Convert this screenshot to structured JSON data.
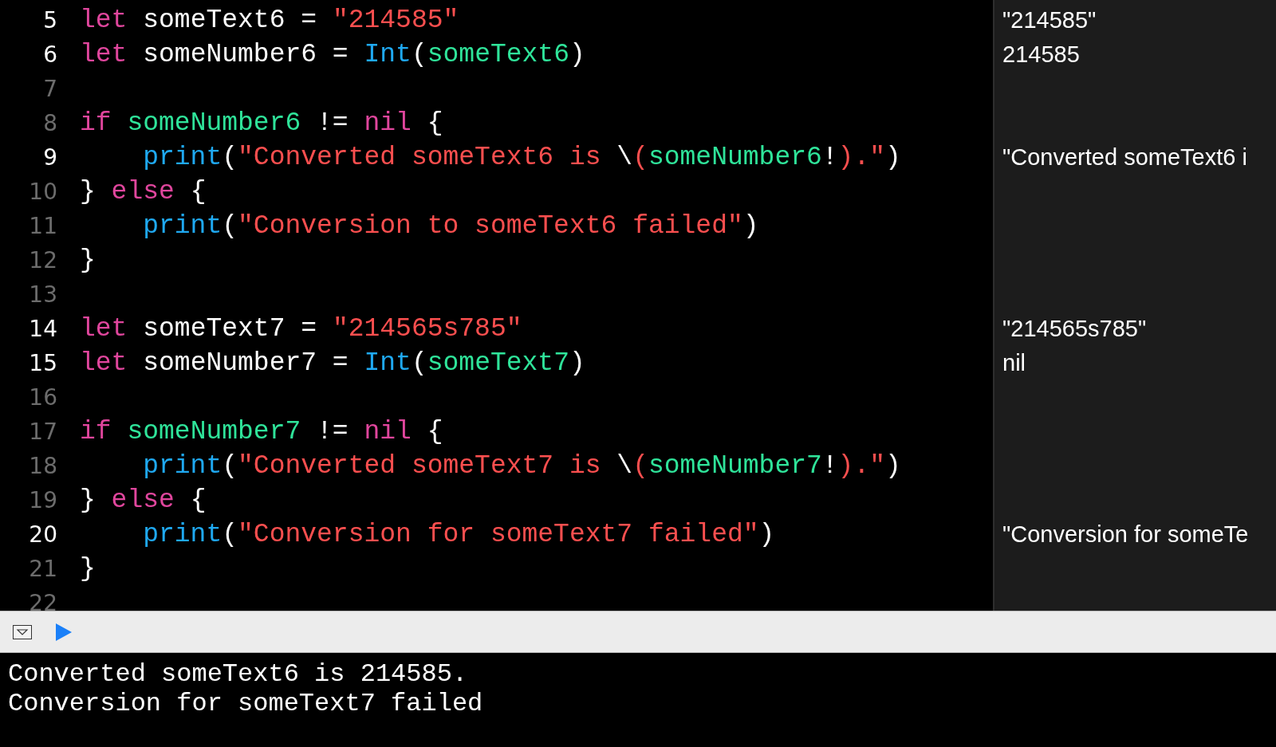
{
  "editor": {
    "lines": [
      {
        "number": "5",
        "highlighted": true,
        "tokens": [
          {
            "kind": "keyword",
            "text": "let"
          },
          {
            "kind": "plain",
            "text": " someText6 = "
          },
          {
            "kind": "string",
            "text": "\"214585\""
          }
        ],
        "result": "\"214585\""
      },
      {
        "number": "6",
        "highlighted": true,
        "tokens": [
          {
            "kind": "keyword",
            "text": "let"
          },
          {
            "kind": "plain",
            "text": " someNumber6 = "
          },
          {
            "kind": "type",
            "text": "Int"
          },
          {
            "kind": "plain",
            "text": "("
          },
          {
            "kind": "variable",
            "text": "someText6"
          },
          {
            "kind": "plain",
            "text": ")"
          }
        ],
        "result": "214585"
      },
      {
        "number": "7",
        "highlighted": false
      },
      {
        "number": "8",
        "highlighted": false,
        "tokens": [
          {
            "kind": "keyword",
            "text": "if "
          },
          {
            "kind": "variable",
            "text": "someNumber6"
          },
          {
            "kind": "plain",
            "text": " != "
          },
          {
            "kind": "keyword",
            "text": "nil"
          },
          {
            "kind": "plain",
            "text": " {"
          }
        ]
      },
      {
        "number": "9",
        "highlighted": true,
        "tokens": [
          {
            "kind": "type",
            "text": "    print"
          },
          {
            "kind": "plain",
            "text": "("
          },
          {
            "kind": "string",
            "text": "\"Converted someText6 is "
          },
          {
            "kind": "plain",
            "text": "\\"
          },
          {
            "kind": "string",
            "text": "("
          },
          {
            "kind": "variable",
            "text": "someNumber6"
          },
          {
            "kind": "plain",
            "text": "!"
          },
          {
            "kind": "string",
            "text": ").\""
          },
          {
            "kind": "plain",
            "text": ")"
          }
        ],
        "result": "\"Converted someText6 i"
      },
      {
        "number": "10",
        "highlighted": false,
        "tokens": [
          {
            "kind": "plain",
            "text": "} "
          },
          {
            "kind": "keyword",
            "text": "else"
          },
          {
            "kind": "plain",
            "text": " {"
          }
        ]
      },
      {
        "number": "11",
        "highlighted": false,
        "tokens": [
          {
            "kind": "type",
            "text": "    print"
          },
          {
            "kind": "plain",
            "text": "("
          },
          {
            "kind": "string",
            "text": "\"Conversion to someText6 failed\""
          },
          {
            "kind": "plain",
            "text": ")"
          }
        ]
      },
      {
        "number": "12",
        "highlighted": false,
        "tokens": [
          {
            "kind": "plain",
            "text": "}"
          }
        ]
      },
      {
        "number": "13",
        "highlighted": false
      },
      {
        "number": "14",
        "highlighted": true,
        "tokens": [
          {
            "kind": "keyword",
            "text": "let"
          },
          {
            "kind": "plain",
            "text": " someText7 = "
          },
          {
            "kind": "string",
            "text": "\"214565s785\""
          }
        ],
        "result": "\"214565s785\""
      },
      {
        "number": "15",
        "highlighted": true,
        "tokens": [
          {
            "kind": "keyword",
            "text": "let"
          },
          {
            "kind": "plain",
            "text": " someNumber7 = "
          },
          {
            "kind": "type",
            "text": "Int"
          },
          {
            "kind": "plain",
            "text": "("
          },
          {
            "kind": "variable",
            "text": "someText7"
          },
          {
            "kind": "plain",
            "text": ")"
          }
        ],
        "result": "nil"
      },
      {
        "number": "16",
        "highlighted": false
      },
      {
        "number": "17",
        "highlighted": false,
        "tokens": [
          {
            "kind": "keyword",
            "text": "if "
          },
          {
            "kind": "variable",
            "text": "someNumber7"
          },
          {
            "kind": "plain",
            "text": " != "
          },
          {
            "kind": "keyword",
            "text": "nil"
          },
          {
            "kind": "plain",
            "text": " {"
          }
        ]
      },
      {
        "number": "18",
        "highlighted": false,
        "tokens": [
          {
            "kind": "type",
            "text": "    print"
          },
          {
            "kind": "plain",
            "text": "("
          },
          {
            "kind": "string",
            "text": "\"Converted someText7 is "
          },
          {
            "kind": "plain",
            "text": "\\"
          },
          {
            "kind": "string",
            "text": "("
          },
          {
            "kind": "variable",
            "text": "someNumber7"
          },
          {
            "kind": "plain",
            "text": "!"
          },
          {
            "kind": "string",
            "text": ").\""
          },
          {
            "kind": "plain",
            "text": ")"
          }
        ]
      },
      {
        "number": "19",
        "highlighted": false,
        "tokens": [
          {
            "kind": "plain",
            "text": "} "
          },
          {
            "kind": "keyword",
            "text": "else"
          },
          {
            "kind": "plain",
            "text": " {"
          }
        ]
      },
      {
        "number": "20",
        "highlighted": true,
        "tokens": [
          {
            "kind": "type",
            "text": "    print"
          },
          {
            "kind": "plain",
            "text": "("
          },
          {
            "kind": "string",
            "text": "\"Conversion for someText7 failed\""
          },
          {
            "kind": "plain",
            "text": ")"
          }
        ],
        "result": "\"Conversion for someTe"
      },
      {
        "number": "21",
        "highlighted": false,
        "tokens": [
          {
            "kind": "plain",
            "text": "}"
          }
        ]
      },
      {
        "number": "22",
        "highlighted": false
      }
    ]
  },
  "console": {
    "lines": [
      "Converted someText6 is 214585.",
      "Conversion for someText7 failed"
    ]
  }
}
